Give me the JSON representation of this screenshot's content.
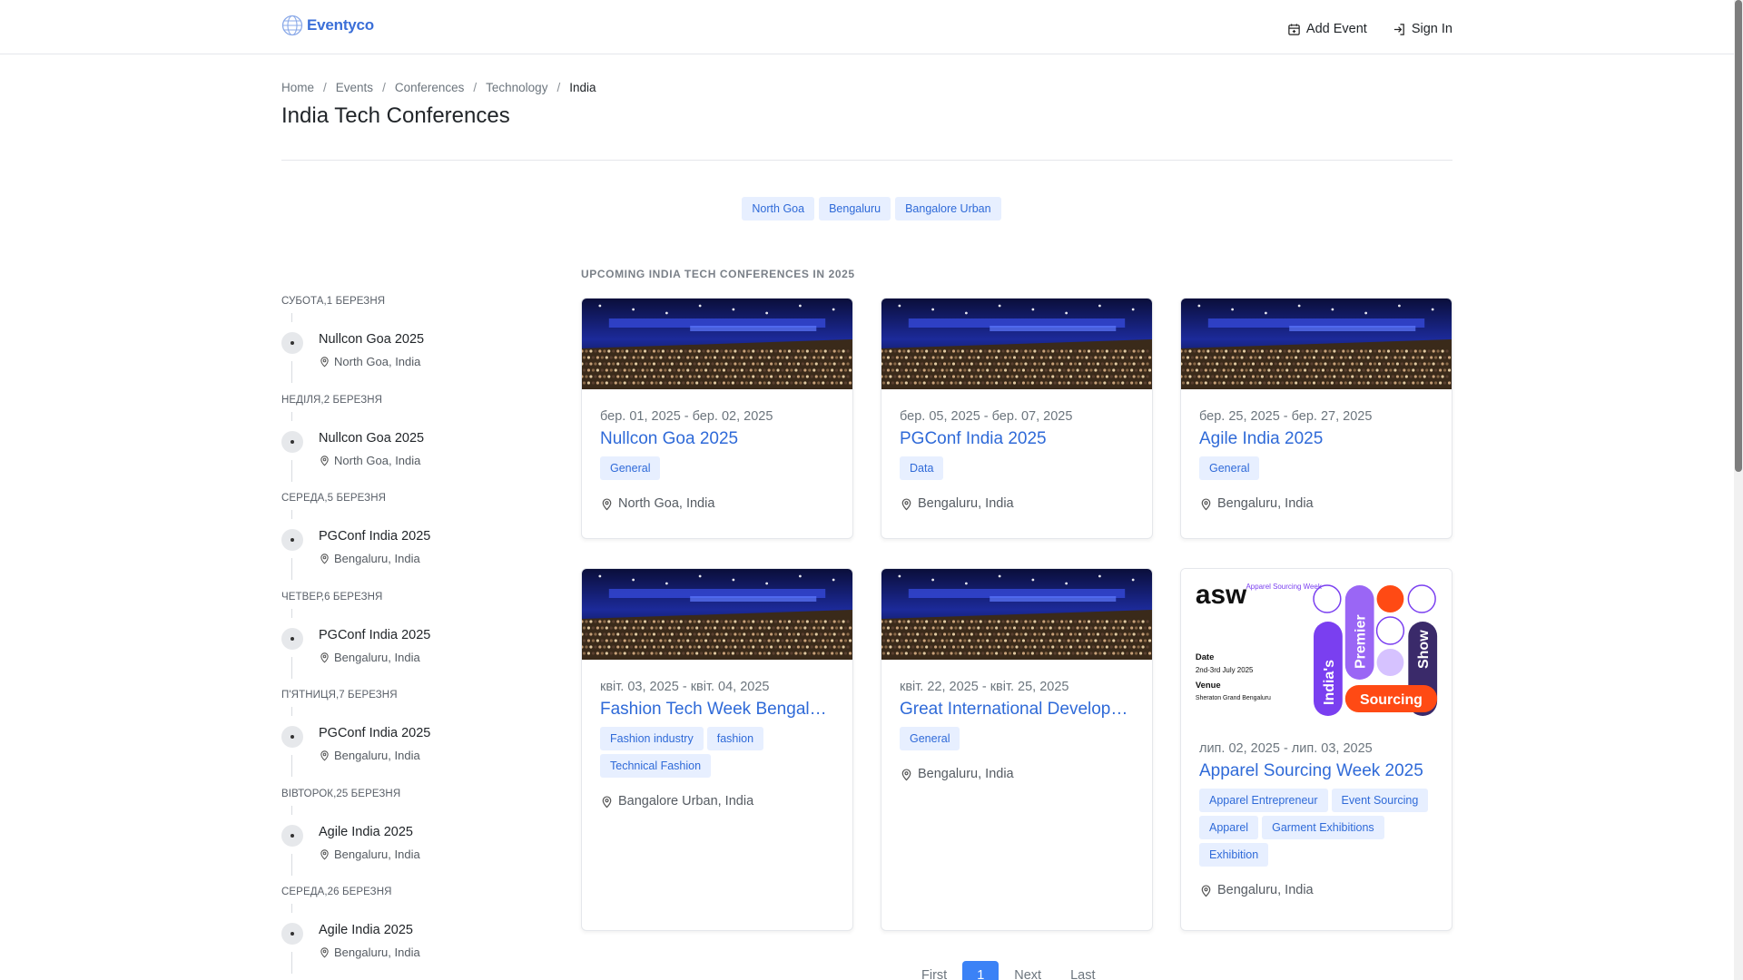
{
  "brand": {
    "name": "Eventyco"
  },
  "nav": {
    "add_event": "Add Event",
    "sign_in": "Sign In"
  },
  "breadcrumb": [
    "Home",
    "Events",
    "Conferences",
    "Technology",
    "India"
  ],
  "page_title": "India Tech Conferences",
  "location_chips": [
    "North Goa",
    "Bengaluru",
    "Bangalore Urban"
  ],
  "section_label": "Upcoming India Tech Conferences in 2025",
  "timeline": [
    {
      "date": "субота,1 березня",
      "title": "Nullcon Goa 2025",
      "location": "North Goa, India"
    },
    {
      "date": "неділя,2 березня",
      "title": "Nullcon Goa 2025",
      "location": "North Goa, India"
    },
    {
      "date": "середа,5 березня",
      "title": "PGConf India 2025",
      "location": "Bengaluru, India"
    },
    {
      "date": "четвер,6 березня",
      "title": "PGConf India 2025",
      "location": "Bengaluru, India"
    },
    {
      "date": "п'ятниця,7 березня",
      "title": "PGConf India 2025",
      "location": "Bengaluru, India"
    },
    {
      "date": "вівторок,25 березня",
      "title": "Agile India 2025",
      "location": "Bengaluru, India"
    },
    {
      "date": "середа,26 березня",
      "title": "Agile India 2025",
      "location": "Bengaluru, India"
    }
  ],
  "cards": [
    {
      "dates": "бер. 01, 2025 - бер. 02, 2025",
      "title": "Nullcon Goa 2025",
      "tags": [
        "General"
      ],
      "location": "North Goa, India"
    },
    {
      "dates": "бер. 05, 2025 - бер. 07, 2025",
      "title": "PGConf India 2025",
      "tags": [
        "Data"
      ],
      "location": "Bengaluru, India"
    },
    {
      "dates": "бер. 25, 2025 - бер. 27, 2025",
      "title": "Agile India 2025",
      "tags": [
        "General"
      ],
      "location": "Bengaluru, India"
    },
    {
      "dates": "квіт. 03, 2025 - квіт. 04, 2025",
      "title": "Fashion Tech Week Bengaluru",
      "tags": [
        "Fashion industry",
        "fashion",
        "Technical Fashion"
      ],
      "location": "Bangalore Urban, India"
    },
    {
      "dates": "квіт. 22, 2025 - квіт. 25, 2025",
      "title": "Great International Developers Summit",
      "tags": [
        "General"
      ],
      "location": "Bengaluru, India"
    },
    {
      "dates": "лип. 02, 2025 - лип. 03, 2025",
      "title": "Apparel Sourcing Week 2025",
      "tags": [
        "Apparel Entrepreneur",
        "Event Sourcing",
        "Apparel",
        "Garment Exhibitions",
        "Exhibition"
      ],
      "location": "Bengaluru, India"
    }
  ],
  "asw_poster": {
    "logo": "asw",
    "logo_sub": "Apparel Sourcing Week",
    "date_label": "Date",
    "date_value": "2nd-3rd July 2025",
    "venue_label": "Venue",
    "venue_value": "Sheraton Grand Bengaluru",
    "word_1": "India's",
    "word_2": "Premier",
    "word_3": "Show",
    "word_4": "Sourcing"
  },
  "pagination": {
    "first": "First",
    "current": "1",
    "next": "Next",
    "last": "Last"
  }
}
